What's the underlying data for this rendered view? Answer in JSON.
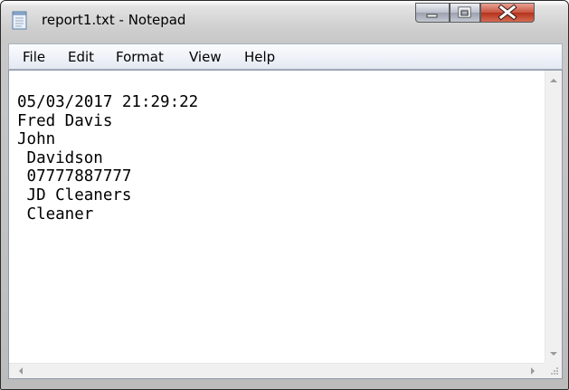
{
  "window": {
    "title": "report1.txt - Notepad",
    "icons": {
      "app": "notepad-icon",
      "minimize": "minimize-icon",
      "maximize": "maximize-icon",
      "close": "close-icon"
    }
  },
  "menu": {
    "items": [
      "File",
      "Edit",
      "Format",
      "View",
      "Help"
    ]
  },
  "document": {
    "lines": [
      "",
      "05/03/2017 21:29:22",
      "Fred Davis",
      "John",
      " Davidson",
      " 07777887777",
      " JD Cleaners",
      " Cleaner"
    ]
  },
  "scrollbars": {
    "icons": {
      "up": "scroll-up-arrow-icon",
      "down": "scroll-down-arrow-icon",
      "left": "scroll-left-arrow-icon",
      "right": "scroll-right-arrow-icon",
      "grip": "size-grip-icon"
    }
  }
}
